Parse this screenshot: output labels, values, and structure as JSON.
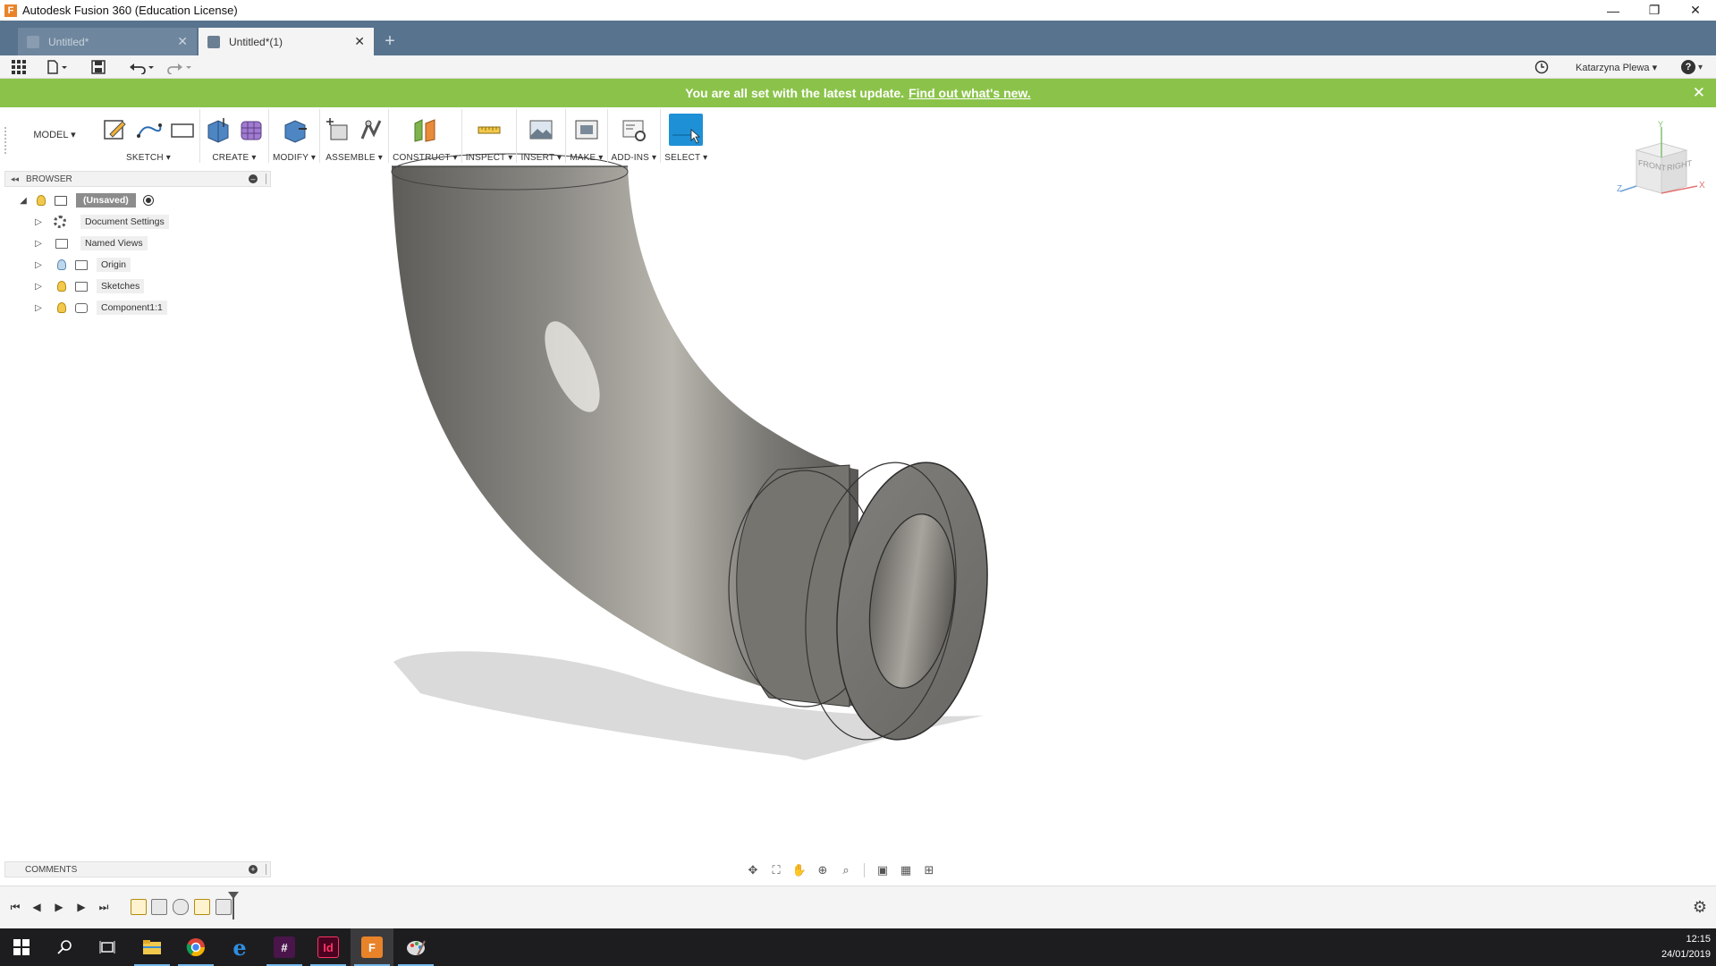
{
  "window": {
    "title": "Autodesk Fusion 360 (Education License)",
    "minimize": "—",
    "restore": "❐",
    "close": "✕"
  },
  "tabs": [
    {
      "label": "Untitled*",
      "close": "✕"
    },
    {
      "label": "Untitled*(1)",
      "close": "✕"
    }
  ],
  "tab_add": "+",
  "quick_access": {
    "user": "Katarzyna Plewa ▾",
    "help": "?",
    "help_caret": "▾"
  },
  "banner": {
    "message": "You are all set with the latest update.",
    "link": "Find out what's new.",
    "close": "✕",
    "color": "#8bc34a"
  },
  "toolbar": {
    "workspace": "MODEL ▾",
    "groups": [
      {
        "label": "SKETCH ▾"
      },
      {
        "label": "CREATE ▾"
      },
      {
        "label": "MODIFY ▾"
      },
      {
        "label": "ASSEMBLE ▾"
      },
      {
        "label": "CONSTRUCT ▾"
      },
      {
        "label": "INSPECT ▾"
      },
      {
        "label": "INSERT ▾"
      },
      {
        "label": "MAKE ▾"
      },
      {
        "label": "ADD-INS ▾"
      },
      {
        "label": "SELECT ▾"
      }
    ],
    "accent": "#1e90d6"
  },
  "browser": {
    "title": "BROWSER",
    "collapse": "◂◂",
    "minimize": "–",
    "root": "(Unsaved)",
    "items": [
      {
        "label": "Document Settings"
      },
      {
        "label": "Named Views"
      },
      {
        "label": "Origin"
      },
      {
        "label": "Sketches"
      },
      {
        "label": "Component1:1"
      }
    ]
  },
  "viewcube": {
    "front": "FRONT",
    "right": "RIGHT",
    "x": "X",
    "y": "Y",
    "z": "Z"
  },
  "comments": {
    "title": "COMMENTS",
    "add": "+"
  },
  "taskbar": {
    "time": "12:15",
    "date": "24/01/2019",
    "indesign": "Id",
    "fusion": "F"
  }
}
